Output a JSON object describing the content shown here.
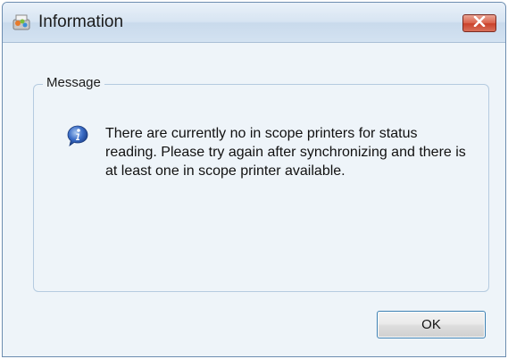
{
  "window": {
    "title": "Information",
    "close_icon": "close-icon",
    "app_icon": "application-icon"
  },
  "message_group": {
    "label": "Message",
    "icon": "information-icon",
    "text": "There are currently no in scope printers for status reading. Please try again after synchronizing and there is at least one in scope printer available."
  },
  "buttons": {
    "ok_label": "OK"
  },
  "colors": {
    "client_background": "#eef4f9",
    "close_button_red": "#c9412a",
    "button_focus_border": "#3c7fb1"
  }
}
